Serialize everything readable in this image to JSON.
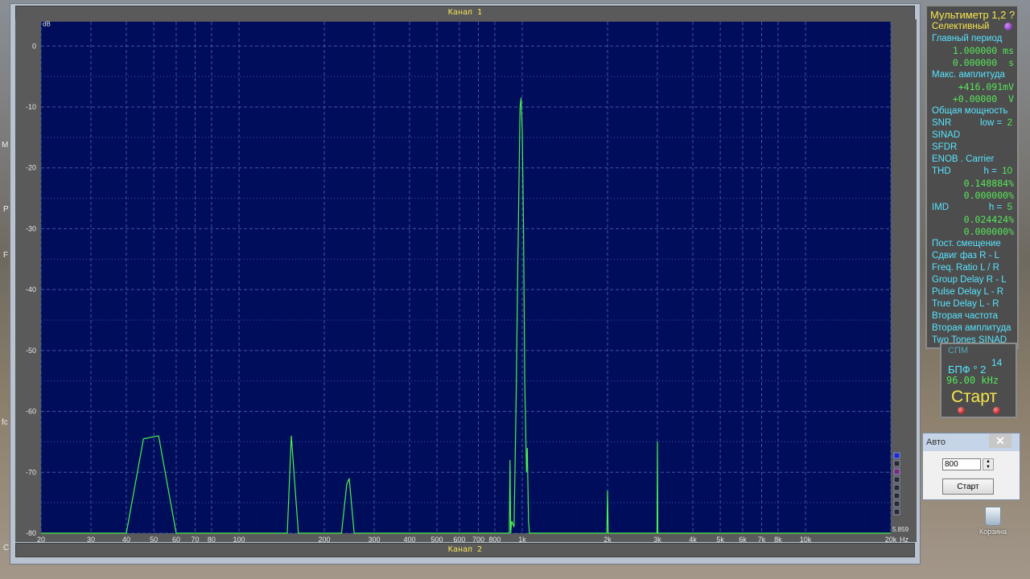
{
  "desktop": {
    "edge_hints": [
      "M",
      "P",
      "F",
      "fc",
      "C"
    ],
    "recycle_bin_label": "Корзина"
  },
  "analyzer": {
    "channel1_label": "Канал 1",
    "channel2_label": "Канал 2",
    "side_value": "5.859",
    "colors": {
      "plot_bg": "#000d5b",
      "trace": "#4cf04c",
      "grid": "#3c57a8",
      "tick_text": "#e6e6e6"
    },
    "side_swatches": [
      "#1a2ad8",
      "#2a2a2a",
      "#7a2a7a",
      "#2a2a2a",
      "#2a2a2a",
      "#2a2a2a",
      "#2a2a2a",
      "#2a2a2a"
    ]
  },
  "chart_data": {
    "type": "line",
    "xscale": "log",
    "xlim": [
      20,
      20000
    ],
    "ylim": [
      -80,
      4
    ],
    "ylabel": "dB",
    "xlabel": "Hz",
    "grid": true,
    "yticks": [
      0,
      -10,
      -20,
      -30,
      -40,
      -50,
      -60,
      -70,
      -80
    ],
    "xticks": [
      20,
      30,
      40,
      50,
      60,
      70,
      80,
      100,
      200,
      300,
      400,
      500,
      600,
      700,
      800,
      1000,
      2000,
      3000,
      4000,
      5000,
      6000,
      7000,
      8000,
      10000,
      20000
    ],
    "xticklabels": [
      "20",
      "30",
      "40",
      "50",
      "60",
      "70",
      "80",
      "100",
      "200",
      "300",
      "400",
      "500",
      "600",
      "700",
      "800",
      "1k",
      "2k",
      "3k",
      "4k",
      "5k",
      "6k",
      "7k",
      "8k",
      "10k",
      "20k"
    ],
    "series": [
      {
        "x": [
          20,
          40,
          46,
          52,
          60,
          62,
          148,
          153,
          162,
          230,
          240,
          245,
          255,
          900,
          905,
          910,
          918,
          935,
          950,
          962,
          975,
          982,
          990,
          1000,
          1010,
          1020,
          1035,
          1042,
          1052,
          1060,
          1070,
          1080,
          1990,
          2000,
          2010,
          2990,
          3000,
          3010,
          20000
        ],
        "y": [
          -80,
          -80,
          -64.5,
          -64,
          -80,
          -80,
          -80,
          -64,
          -80,
          -80,
          -72,
          -71,
          -80,
          -80,
          -68,
          -80,
          -78,
          -79,
          -60,
          -40,
          -20,
          -10,
          -8.5,
          -14,
          -30,
          -55,
          -70,
          -66,
          -78,
          -80,
          -80,
          -80,
          -80,
          -73,
          -80,
          -80,
          -65,
          -80,
          -80
        ]
      }
    ]
  },
  "multimeter": {
    "title": "Мультиметр 1,2 ?",
    "mode": "Селективный",
    "main_period_label": "Главный период",
    "period_val1": "1.000000",
    "period_unit1": "ms",
    "period_val2": "0.000000",
    "period_unit2": "s",
    "max_amp_label": "Макс. амплитуда",
    "amp_val1": "+416.091",
    "amp_unit1": "mV",
    "amp_val2": "+0.00000",
    "amp_unit2": "V",
    "total_power_label": "Общая мощность",
    "snr_label": "SNR",
    "snr_low_label": "low =",
    "snr_low_value": "2",
    "sinad_label": "SINAD",
    "sfdr_label": "SFDR",
    "enob_label": "ENOB . Carrier",
    "thd_label": "THD",
    "thd_h_label": "h =",
    "thd_h_value": "10",
    "thd_val1": "0.148884",
    "thd_val2": "0.000000",
    "imd_label": "IMD",
    "imd_h_label": "h =",
    "imd_h_value": "5",
    "imd_val1": "0.024424",
    "imd_val2": "0.000000",
    "percent": "%",
    "dc_offset_label": "Пост. смещение",
    "phase_label": "Сдвиг фаз R - L",
    "freq_ratio_label": "Freq. Ratio  L / R",
    "group_delay_label": "Group Delay R - L",
    "pulse_delay_label": "Pulse Delay L - R",
    "true_delay_label": "True  Delay L - R",
    "second_freq_label": "Вторая частота",
    "second_amp_label": "Вторая амплитуда",
    "two_tones_label": "Two Tones SINAD"
  },
  "control": {
    "spm_label": "СПМ",
    "fft_label": "БПФ ° 2",
    "fft_exponent": "14",
    "sample_rate": "96.00 kHz",
    "start_label": "Старт"
  },
  "auto_dialog": {
    "title": "Авто",
    "close_glyph": "✕",
    "input_value": "800",
    "start_label": "Старт"
  }
}
